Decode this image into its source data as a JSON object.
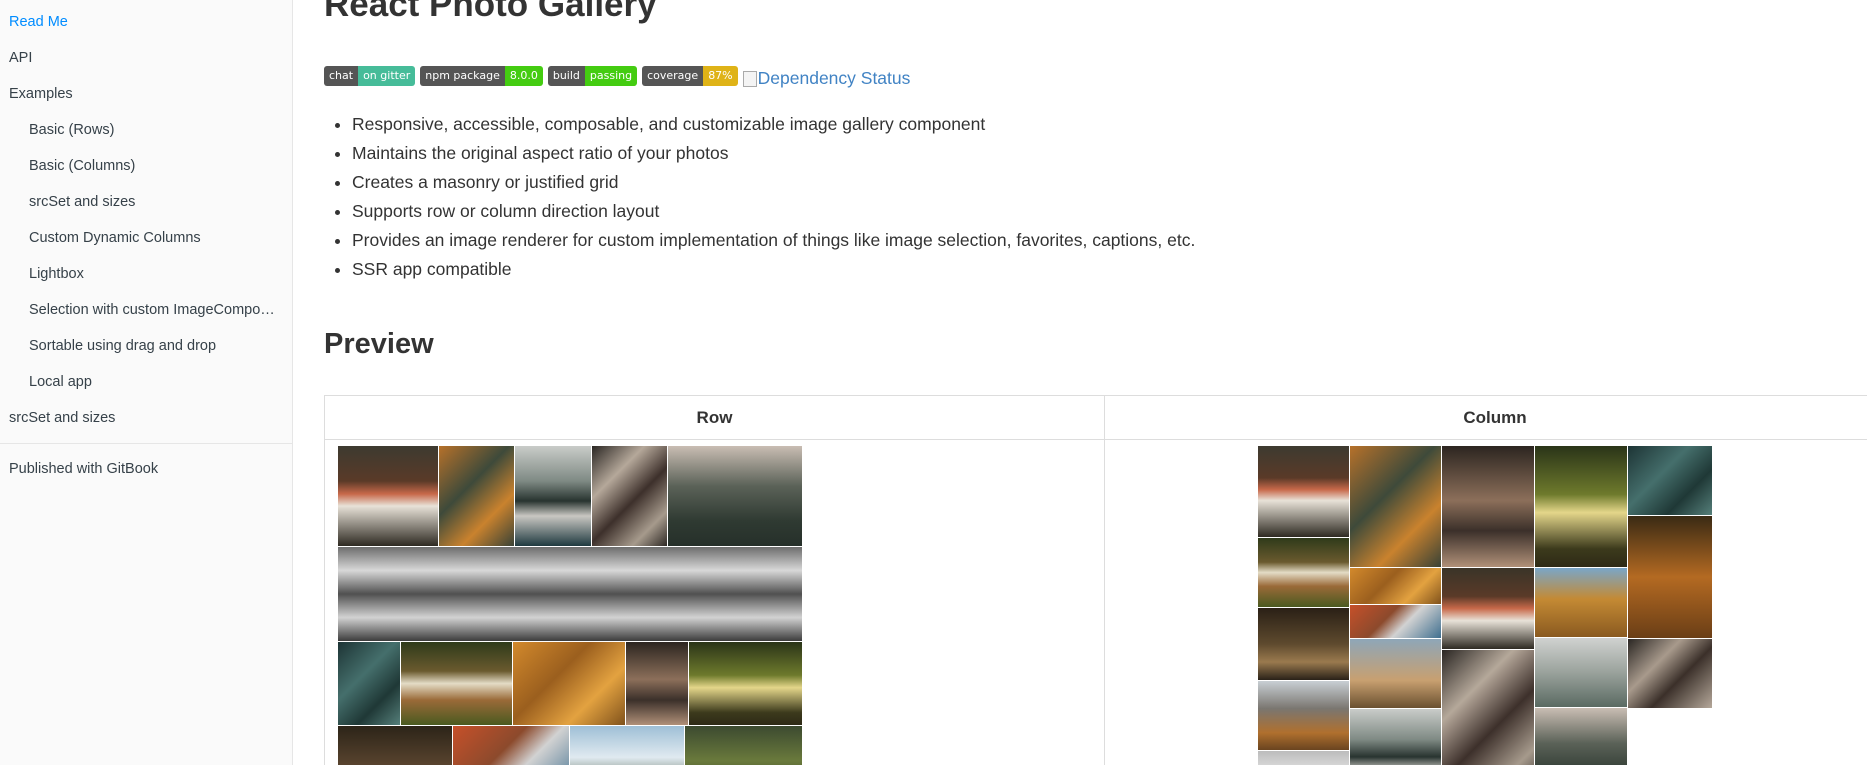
{
  "sidebar": {
    "items": [
      {
        "label": "Read Me",
        "active": true,
        "sub": false
      },
      {
        "label": "API",
        "sub": false
      },
      {
        "label": "Examples",
        "sub": false
      },
      {
        "label": "Basic (Rows)",
        "sub": true
      },
      {
        "label": "Basic (Columns)",
        "sub": true
      },
      {
        "label": "srcSet and sizes",
        "sub": true
      },
      {
        "label": "Custom Dynamic Columns",
        "sub": true
      },
      {
        "label": "Lightbox",
        "sub": true
      },
      {
        "label": "Selection with custom ImageCompo…",
        "sub": true
      },
      {
        "label": "Sortable using drag and drop",
        "sub": true
      },
      {
        "label": "Local app",
        "sub": true
      },
      {
        "label": "srcSet and sizes",
        "sub": false
      }
    ],
    "published": "Published with GitBook"
  },
  "main": {
    "title": "React Photo Gallery",
    "badges": [
      {
        "left": "chat",
        "right": "on gitter",
        "color": "#46bc99"
      },
      {
        "left": "npm package",
        "right": "8.0.0",
        "color": "#4c1"
      },
      {
        "left": "build",
        "right": "passing",
        "color": "#4c1"
      },
      {
        "left": "coverage",
        "right": "87%",
        "color": "#dfb317"
      }
    ],
    "dependency_alt": "Dependency Status",
    "features": [
      "Responsive, accessible, composable, and customizable image gallery component",
      "Maintains the original aspect ratio of your photos",
      "Creates a masonry or justified grid",
      "Supports row or column direction layout",
      "Provides an image renderer for custom implementation of things like image selection, favorites, captions, etc.",
      "SSR app compatible"
    ],
    "preview_title": "Preview",
    "table_headers": {
      "row": "Row",
      "column": "Column"
    }
  },
  "photos": {
    "row": [
      {
        "name": "mushroom",
        "bg": "linear-gradient(180deg,#3d3a30 0%,#5a3a28 35%,#c8694a 48%,#e8e2d8 60%,#2e2a22 100%)"
      },
      {
        "name": "autumn-forest",
        "bg": "linear-gradient(135deg,#b6712a 0%,#3e4a3a 40%,#c9822e 70%,#394236 100%)"
      },
      {
        "name": "misty-lake",
        "bg": "linear-gradient(180deg,#c9ccc9 0%,#7f8a84 35%,#283430 55%,#c9c7c2 70%,#1f3a40 100%)"
      },
      {
        "name": "ferns",
        "bg": "linear-gradient(135deg,#2a2623 0%,#b5a89a 30%,#3d302b 55%,#a69a8c 80%,#2e2925 100%)"
      },
      {
        "name": "foggy-hill",
        "bg": "linear-gradient(180deg,#c9bdb3 0%,#5b6258 40%,#2f3a32 75%,#26302a 100%)"
      },
      {
        "name": "snowy-valley",
        "bg": "linear-gradient(180deg,#6d6d6d 0%,#d8d8d8 25%,#505050 50%,#d2d2d2 75%,#3c3c3c 100%)"
      },
      {
        "name": "teal-leaves",
        "bg": "linear-gradient(135deg,#1d3435 0%,#456f6c 40%,#1f3836 70%,#557f7a 100%)"
      },
      {
        "name": "acorn",
        "bg": "linear-gradient(180deg,#2f3a1a 0%,#6a5a2e 35%,#e4dcc6 50%,#9a6a38 70%,#4a5a20 100%)"
      },
      {
        "name": "autumn-canopy",
        "bg": "linear-gradient(135deg,#d2892c 0%,#9b5f1e 40%,#e3a240 70%,#80521c 100%)"
      },
      {
        "name": "dry-leaves",
        "bg": "linear-gradient(180deg,#2c2520 0%,#8c6f5a 45%,#3b302a 70%,#b09078 100%)"
      },
      {
        "name": "forest-path",
        "bg": "linear-gradient(180deg,#2a3418 0%,#6e7a2c 40%,#e4d68a 55%,#3c3a1c 85%,#2e2a16 100%)"
      },
      {
        "name": "dark-forest",
        "bg": "linear-gradient(180deg,#2c2418 0%,#5c4630 60%,#1e1a14 100%)"
      },
      {
        "name": "picnic",
        "bg": "linear-gradient(135deg,#c6502a 0%,#8c4a2c 40%,#d2d2d2 60%,#3f6f8f 100%)"
      },
      {
        "name": "mountain-sky",
        "bg": "linear-gradient(180deg,#9fbfd6 0%,#e0eaf0 45%,#6c7a6a 80%,#3a4a3a 100%)"
      },
      {
        "name": "pine-slope",
        "bg": "linear-gradient(180deg,#3c4a30 0%,#6a7a3c 50%,#2c3822 100%)"
      }
    ],
    "column": [
      {
        "name": "mushroom",
        "bg": "linear-gradient(180deg,#3d3a30 0%,#5a3a28 35%,#c8694a 48%,#e8e2d8 60%,#2e2a22 100%)"
      },
      {
        "name": "acorn",
        "bg": "linear-gradient(180deg,#2f3a1a 0%,#6a5a2e 35%,#e4dcc6 50%,#9a6a38 70%,#4a5a20 100%)"
      },
      {
        "name": "forest-road",
        "bg": "linear-gradient(180deg,#2a2016 0%,#5e4a2e 50%,#9a7a4e 75%,#2a2218 100%)"
      },
      {
        "name": "autumn-mountains",
        "bg": "linear-gradient(180deg,#c8cfd4 0%,#7a7670 40%,#b0702e 75%,#6a4420 100%)"
      },
      {
        "name": "cloud-peak",
        "bg": "linear-gradient(180deg,#bcbcbc 0%,#e4e4e4 50%,#8a8a8a 100%)"
      },
      {
        "name": "autumn-forest",
        "bg": "linear-gradient(135deg,#b6712a 0%,#3e4a3a 40%,#c9822e 70%,#394236 100%)"
      },
      {
        "name": "autumn-canopy",
        "bg": "linear-gradient(135deg,#d2892c 0%,#9b5f1e 40%,#e3a240 70%,#80521c 100%)"
      },
      {
        "name": "picnic",
        "bg": "linear-gradient(135deg,#c6502a 0%,#8c4a2c 40%,#d2d2d2 60%,#3f6f8f 100%)"
      },
      {
        "name": "blue-hills",
        "bg": "linear-gradient(180deg,#8ea6b8 0%,#c8a070 60%,#6a5030 100%)"
      },
      {
        "name": "misty-lake",
        "bg": "linear-gradient(180deg,#c9ccc9 0%,#7f8a84 35%,#283430 55%,#c9c7c2 70%,#1f3a40 100%)"
      },
      {
        "name": "dry-leaves",
        "bg": "linear-gradient(180deg,#2c2520 0%,#8c6f5a 45%,#3b302a 70%,#b09078 100%)"
      },
      {
        "name": "mushroom-2",
        "bg": "linear-gradient(180deg,#3a3428 0%,#5a3a28 35%,#c8694a 50%,#e8e2d8 65%,#2e2a22 100%)"
      },
      {
        "name": "ferns",
        "bg": "linear-gradient(135deg,#2a2623 0%,#b5a89a 30%,#3d302b 55%,#a69a8c 80%,#2e2925 100%)"
      },
      {
        "name": "forest-path",
        "bg": "linear-gradient(180deg,#2a3418 0%,#6e7a2c 40%,#e4d68a 55%,#3c3a1c 85%,#2e2a16 100%)"
      },
      {
        "name": "autumn-larches",
        "bg": "linear-gradient(180deg,#7aa6c8 0%,#c48a34 45%,#8a5a20 100%)"
      },
      {
        "name": "foggy-valley",
        "bg": "linear-gradient(180deg,#d0d2d0 0%,#9aa29c 50%,#5a6a62 100%)"
      },
      {
        "name": "foggy-hill",
        "bg": "linear-gradient(180deg,#c9bdb3 0%,#5b6258 40%,#2f3a32 75%,#26302a 100%)"
      },
      {
        "name": "teal-leaves",
        "bg": "linear-gradient(135deg,#1d3435 0%,#456f6c 40%,#1f3836 70%,#557f7a 100%)"
      },
      {
        "name": "larch-forest",
        "bg": "linear-gradient(180deg,#3a2a14 0%,#b46a22 50%,#6a3e16 100%)"
      },
      {
        "name": "ferns-2",
        "bg": "linear-gradient(135deg,#2a2623 0%,#a89a8c 35%,#3b302a 60%,#b5a89a 100%)"
      }
    ]
  }
}
